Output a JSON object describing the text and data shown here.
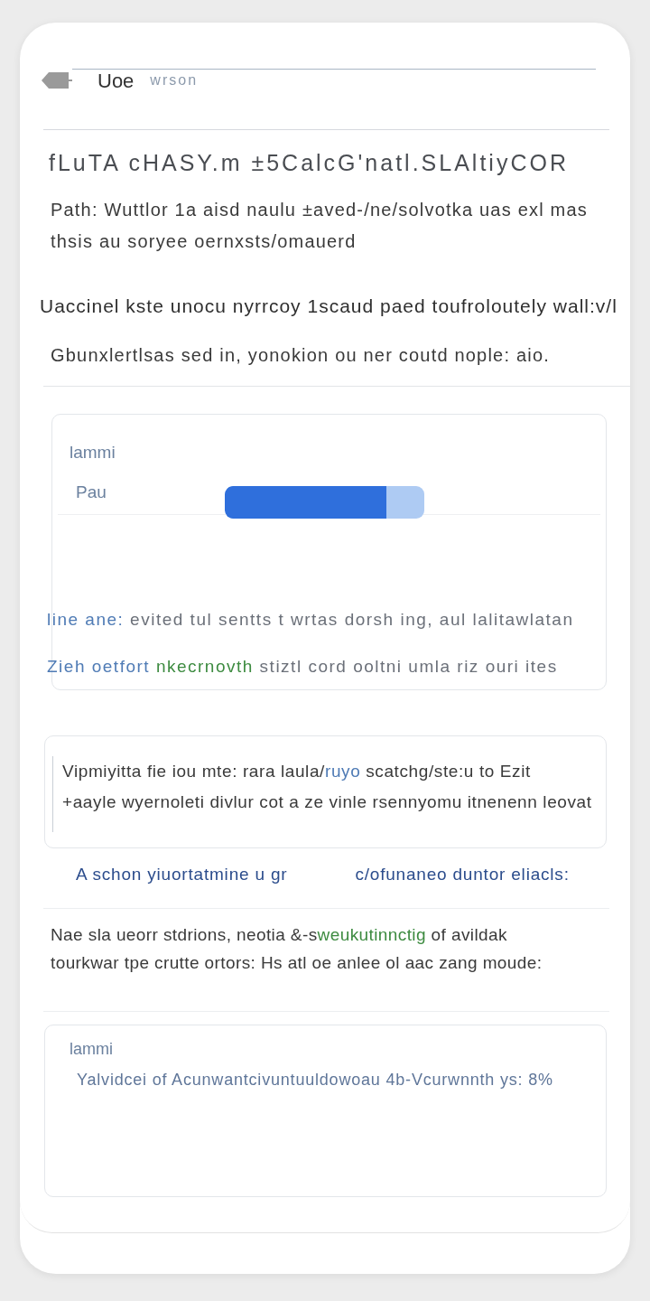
{
  "header": {
    "title": "Uoe",
    "subtitle": "wrson"
  },
  "heading": "fLuTA cHASY.m ±5CalcG'natl.SLAltiyCOR",
  "intro": {
    "lines": [
      {
        "parts": [
          {
            "text": "Path: Wuttlor 1a aisd naulu ±aved-/ne/solvotka uas exl mas",
            "kind": "plain"
          }
        ]
      },
      {
        "parts": [
          {
            "text": "thsis au soryee oernxsts/omauerd",
            "kind": "plain"
          }
        ]
      }
    ]
  },
  "statement": "Uaccinel kste unocu nyrrcoy 1scaud paed toufroloutely wall:v/l",
  "note": "Gbunxlertlsas sed in, yonokion ou ner coutd nople: aio.",
  "card_1": {
    "label": "lammi",
    "sublabel": "Pau",
    "progress": {
      "level": 0.81
    },
    "lines": [
      {
        "parts": [
          {
            "text": "line ane:",
            "kind": "accent"
          },
          {
            "text": " evited tul sentts t wrtas dorsh ing, aul lalitawlatan",
            "kind": "muted"
          }
        ]
      },
      {
        "parts": [
          {
            "text": "Zieh oetfort ",
            "kind": "accent"
          },
          {
            "text": "nkecrnovth",
            "kind": "highlight"
          },
          {
            "text": " stiztl cord ooltni umla riz ouri ites",
            "kind": "muted"
          }
        ]
      }
    ]
  },
  "card_2": {
    "lines": [
      {
        "parts": [
          {
            "text": "Vipmiyitta fie iou mte: rara laula/",
            "kind": "plain"
          },
          {
            "text": "ruyo",
            "kind": "accent"
          },
          {
            "text": " scatchg/ste:u to Ezit",
            "kind": "plain"
          }
        ]
      },
      {
        "parts": [
          {
            "text": "+aayle wyernoleti divlur cot a ze vinle rsennyomu itnenenn leovat",
            "kind": "plain"
          }
        ]
      }
    ]
  },
  "links": [
    {
      "label": "A schon yiuortatmine u gr"
    },
    {
      "label": "c/ofunaneo duntor eliacls:"
    }
  ],
  "paragraph": {
    "lines": [
      {
        "parts": [
          {
            "text": "Nae sla ueorr stdrions, neotia &-s",
            "kind": "plain"
          },
          {
            "text": "weukutinnctig",
            "kind": "highlight"
          },
          {
            "text": " of avildak",
            "kind": "plain"
          }
        ]
      },
      {
        "parts": [
          {
            "text": "tourkwar tpe crutte ortors: Hs atl oe anlee ol aac zang moude:",
            "kind": "plain"
          }
        ]
      }
    ]
  },
  "card_3": {
    "label": "lammi",
    "text": "Yalvidcei of Acunwantcivuntuuldowoau 4b-Vcurwnnth ys: 8%"
  }
}
